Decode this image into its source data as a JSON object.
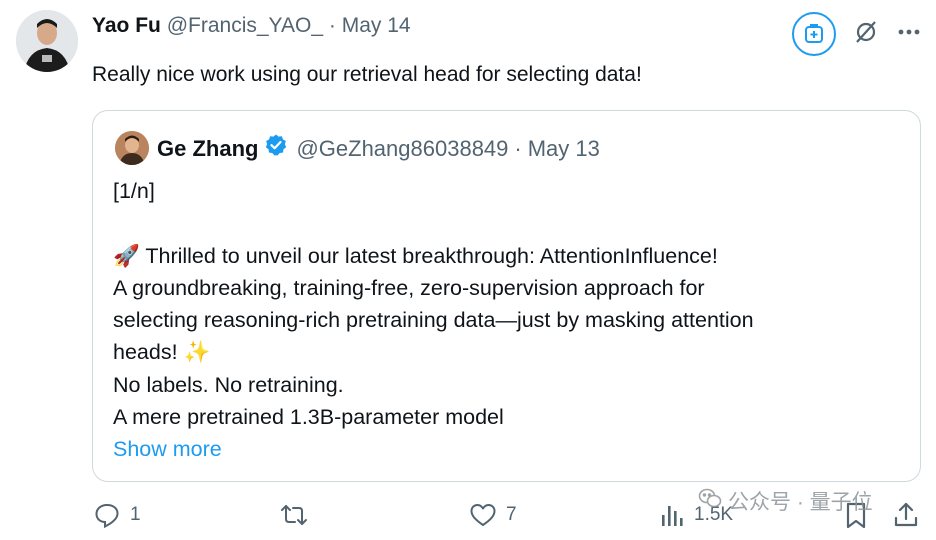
{
  "tweet": {
    "author_name": "Yao Fu",
    "handle": "@Francis_YAO_",
    "separator": "·",
    "date": "May 14",
    "text": "Really nice work using our retrieval head for selecting data!"
  },
  "top_actions": {
    "icons": [
      "grok-icon",
      "no-show-icon",
      "more-icon"
    ]
  },
  "quote": {
    "author_name": "Ge Zhang",
    "handle": "@GeZhang86038849",
    "separator": "·",
    "date": "May 13",
    "lines": [
      "[1/n]",
      "",
      "🚀 Thrilled to unveil our latest breakthrough: AttentionInfluence!",
      "A groundbreaking, training-free, zero-supervision approach for",
      "selecting reasoning-rich pretraining data—just by masking attention",
      "heads! ✨",
      "No labels. No retraining.",
      "A mere pretrained 1.3B-parameter model"
    ],
    "show_more": "Show more"
  },
  "actions": {
    "replies": "1",
    "reposts": "",
    "likes": "7",
    "views": "1.5K"
  },
  "watermark": {
    "text": "公众号 · 量子位"
  },
  "colors": {
    "accent": "#1d9bf0",
    "muted": "#536471",
    "text": "#0f1419",
    "border": "#cfd9de"
  }
}
